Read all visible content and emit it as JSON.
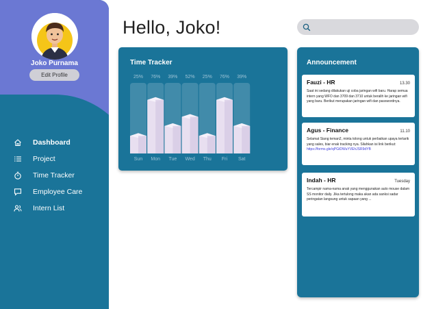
{
  "profile": {
    "name": "Joko Purnama",
    "edit_label": "Edit Profile"
  },
  "nav": {
    "items": [
      {
        "label": "Dashboard",
        "icon": "home-icon",
        "active": true
      },
      {
        "label": "Project",
        "icon": "list-icon",
        "active": false
      },
      {
        "label": "Time Tracker",
        "icon": "stopwatch-icon",
        "active": false
      },
      {
        "label": "Employee Care",
        "icon": "chat-icon",
        "active": false
      },
      {
        "label": "Intern List",
        "icon": "users-icon",
        "active": false
      }
    ]
  },
  "header": {
    "greeting": "Hello, Joko!",
    "search_placeholder": ""
  },
  "time_tracker": {
    "title": "Time Tracker"
  },
  "chart_data": {
    "type": "bar",
    "categories": [
      "Sun",
      "Mon",
      "Tue",
      "Wed",
      "Thu",
      "Fri",
      "Sat"
    ],
    "values": [
      25,
      76,
      39,
      52,
      25,
      76,
      39
    ],
    "value_labels": [
      "25%",
      "76%",
      "39%",
      "52%",
      "25%",
      "76%",
      "39%"
    ],
    "ylim": [
      0,
      100
    ]
  },
  "announcements": {
    "title": "Announcement",
    "items": [
      {
        "sender": "Fauzi - HR",
        "time": "13.30",
        "body": "Saat ini sedang dilakukan uji coba jaringan wifi baru. Harap semua intern yang WFO dan 3709 dan 3710 untuk beralih ke jaringan wifi yang baru. Berikut merupakan jaringan wifi dan passwordnya.",
        "link": ""
      },
      {
        "sender": "Agus - Finance",
        "time": "11.10",
        "body": "Selamat Siang teman2, minta tolong untuk perbaikan upaya tertarik yang sales, biar enak tracking nya. Silahkan isi link berikut:",
        "link": "https://forms.gle/qPGtDWuYVEhJSR9dYB"
      },
      {
        "sender": "Indah - HR",
        "time": "Tuesday",
        "body": "Tercampir nama-nama anak yang menggunakan auto mouse dalam SS monitor daily. Jika tertulong maka akan ada sanksi sadar peringatan langsung untuk sapaan yang ...",
        "link": ""
      }
    ]
  },
  "colors": {
    "primary": "#1a7499",
    "sidebar_top": "#6b78d3",
    "bar_face": "#e8dff0",
    "bar_track": "#4f93b0"
  }
}
